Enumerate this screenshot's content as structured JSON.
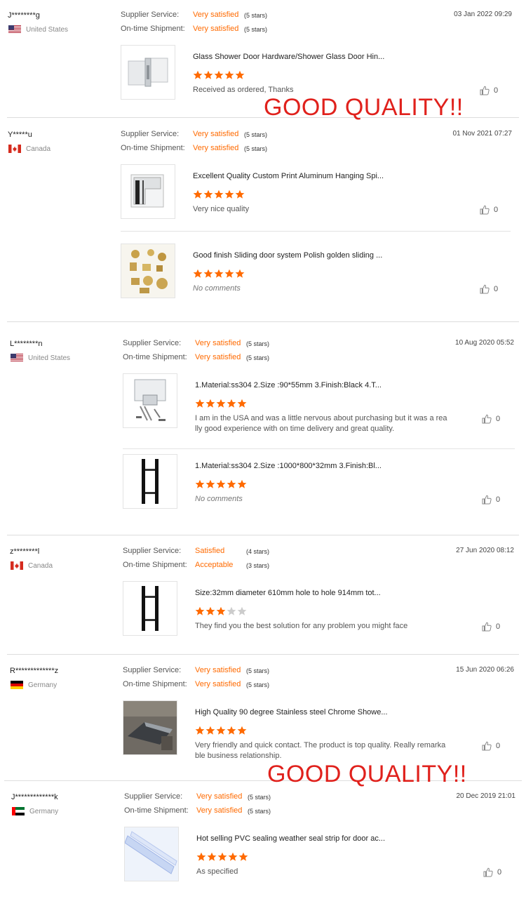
{
  "labels": {
    "supplier_service": "Supplier Service:",
    "ontime_shipment": "On-time Shipment:"
  },
  "colors": {
    "accent": "#ff6a00",
    "star_empty": "#cccccc",
    "banner": "#e0211c"
  },
  "reviews": [
    {
      "user": "J********g",
      "country": "United States",
      "flag": "us",
      "date": "03 Jan 2022 09:29",
      "supplier_value": "Very satisfied",
      "supplier_stars": "(5 stars)",
      "shipment_value": "Very satisfied",
      "shipment_stars": "(5 stars)",
      "products": [
        {
          "title": "Glass Shower Door Hardware/Shower Glass Door Hin...",
          "rating": 5,
          "comment": "Received as ordered, Thanks",
          "likes": "0",
          "img": "hinge-silver"
        }
      ]
    },
    {
      "user": "Y*****u",
      "country": "Canada",
      "flag": "ca",
      "date": "01 Nov 2021 07:27",
      "supplier_value": "Very satisfied",
      "supplier_stars": "(5 stars)",
      "shipment_value": "Very satisfied",
      "shipment_stars": "(5 stars)",
      "products": [
        {
          "title": "Excellent Quality Custom Print Aluminum Hanging Spi...",
          "rating": 5,
          "comment": "Very nice quality",
          "likes": "0",
          "img": "clamp-black"
        },
        {
          "title": "Good finish Sliding door system Polish golden sliding ...",
          "rating": 5,
          "comment": "No comments",
          "likes": "0",
          "img": "golden-parts",
          "no_comment": true
        }
      ]
    },
    {
      "user": "L********n",
      "country": "United States",
      "flag": "us",
      "date": "10 Aug 2020 05:52",
      "supplier_value": "Very satisfied",
      "supplier_stars": "(5 stars)",
      "shipment_value": "Very satisfied",
      "shipment_stars": "(5 stars)",
      "products": [
        {
          "title": "1.Material:ss304 2.Size :90*55mm 3.Finish:Black 4.T...",
          "rating": 5,
          "comment": "I am in the USA and was a little nervous about purchasing but it was a rea\nlly good experience with on time delivery and great quality.",
          "likes": "0",
          "img": "hinge-kit"
        },
        {
          "title": "1.Material:ss304 2.Size :1000*800*32mm 3.Finish:Bl...",
          "rating": 5,
          "comment": "No comments",
          "likes": "0",
          "img": "handle-black",
          "no_comment": true
        }
      ]
    },
    {
      "user": "z********l",
      "country": "Canada",
      "flag": "ca",
      "date": "27 Jun 2020 08:12",
      "supplier_value": "Satisfied",
      "supplier_stars": "(4 stars)",
      "shipment_value": "Acceptable",
      "shipment_stars": "(3 stars)",
      "products": [
        {
          "title": "Size:32mm diameter 610mm hole to hole 914mm tot...",
          "rating": 3,
          "comment": "They find you the best solution for any problem you might face",
          "likes": "0",
          "img": "handle-black"
        }
      ]
    },
    {
      "user": "R*************z",
      "country": "Germany",
      "flag": "de",
      "date": "15 Jun 2020 06:26",
      "supplier_value": "Very satisfied",
      "supplier_stars": "(5 stars)",
      "shipment_value": "Very satisfied",
      "shipment_stars": "(5 stars)",
      "products": [
        {
          "title": "High Quality 90 degree Stainless steel Chrome Showe...",
          "rating": 5,
          "comment": "Very friendly and quick contact. The product is top quality. Really remarka\nble business relationship.",
          "likes": "0",
          "img": "photo-dark"
        }
      ]
    },
    {
      "user": "J*************k",
      "country": "Germany",
      "flag": "ae",
      "date": "20 Dec 2019 21:01",
      "supplier_value": "Very satisfied",
      "supplier_stars": "(5 stars)",
      "shipment_value": "Very satisfied",
      "shipment_stars": "(5 stars)",
      "products": [
        {
          "title": "Hot selling PVC sealing weather seal strip for door ac...",
          "rating": 5,
          "comment": "As specified",
          "likes": "0",
          "img": "pvc-strip"
        }
      ]
    }
  ],
  "banners": [
    "GOOD QUALITY!!",
    "GOOD QUALITY!!"
  ]
}
